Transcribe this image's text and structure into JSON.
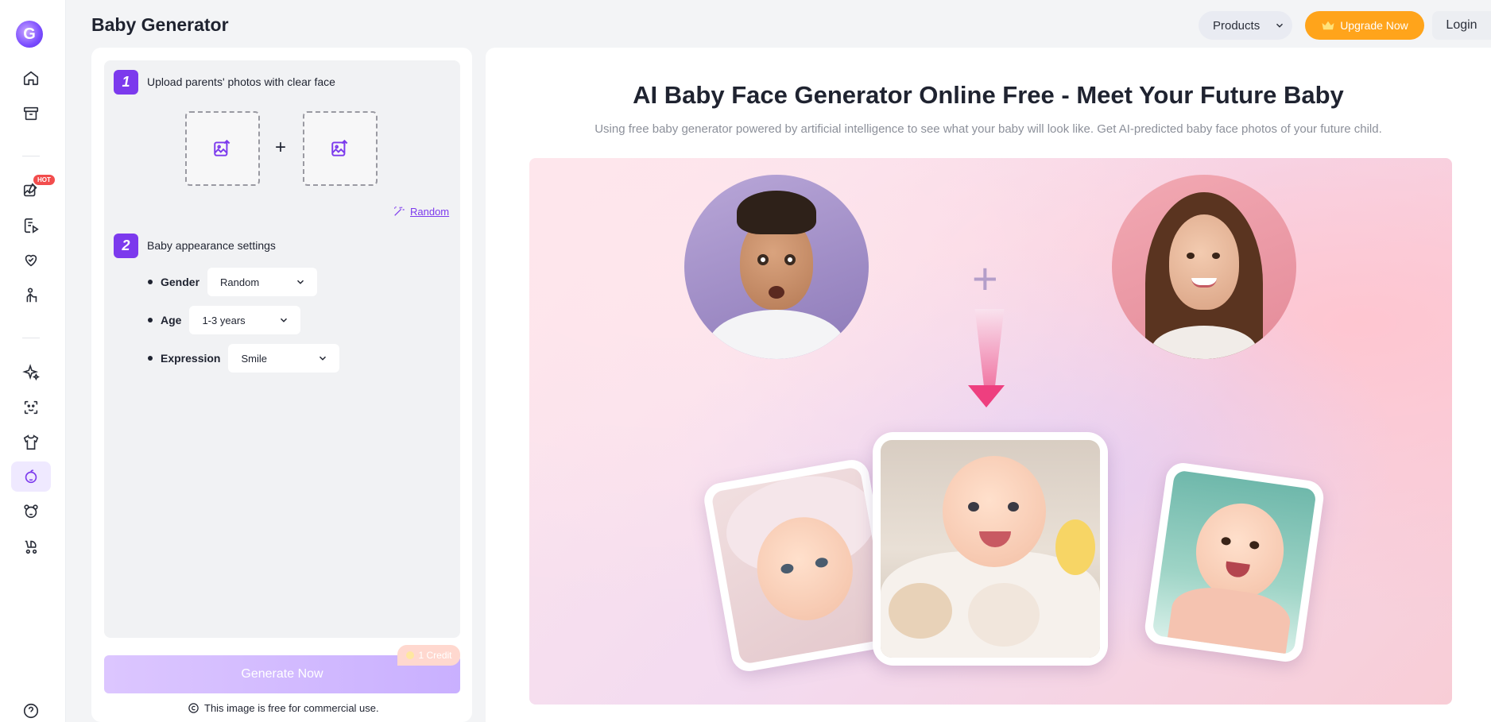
{
  "header": {
    "title": "Baby Generator",
    "products_label": "Products",
    "upgrade_label": "Upgrade Now",
    "login_label": "Login"
  },
  "rail": {
    "logo": "G",
    "hot_badge": "HOT",
    "icons": [
      "home-icon",
      "archive-icon",
      "image-edit-icon",
      "video-doc-icon",
      "heart-hand-icon",
      "person-pose-icon",
      "sparkles-icon",
      "face-scan-icon",
      "shirt-icon",
      "baby-icon",
      "bear-icon",
      "stroller-icon",
      "help-icon"
    ]
  },
  "panel": {
    "step1_number": "1",
    "step1_label": "Upload parents' photos with clear face",
    "plus": "+",
    "random_label": "Random",
    "step2_number": "2",
    "step2_label": "Baby appearance settings",
    "gender_label": "Gender",
    "gender_value": "Random",
    "age_label": "Age",
    "age_value": "1-3 years",
    "expression_label": "Expression",
    "expression_value": "Smile",
    "generate_label": "Generate Now",
    "credit_label": "1 Credit",
    "commercial_note": "This image is free for commercial use."
  },
  "hero": {
    "title": "AI Baby Face Generator Online Free - Meet Your Future Baby",
    "subtitle": "Using free baby generator powered by artificial intelligence to see what your baby will look like. Get AI-predicted baby face photos of your future child.",
    "plus": "+"
  },
  "colors": {
    "accent": "#7c3aed",
    "upgrade": "#ffa41b",
    "hot": "#f24d4d"
  }
}
